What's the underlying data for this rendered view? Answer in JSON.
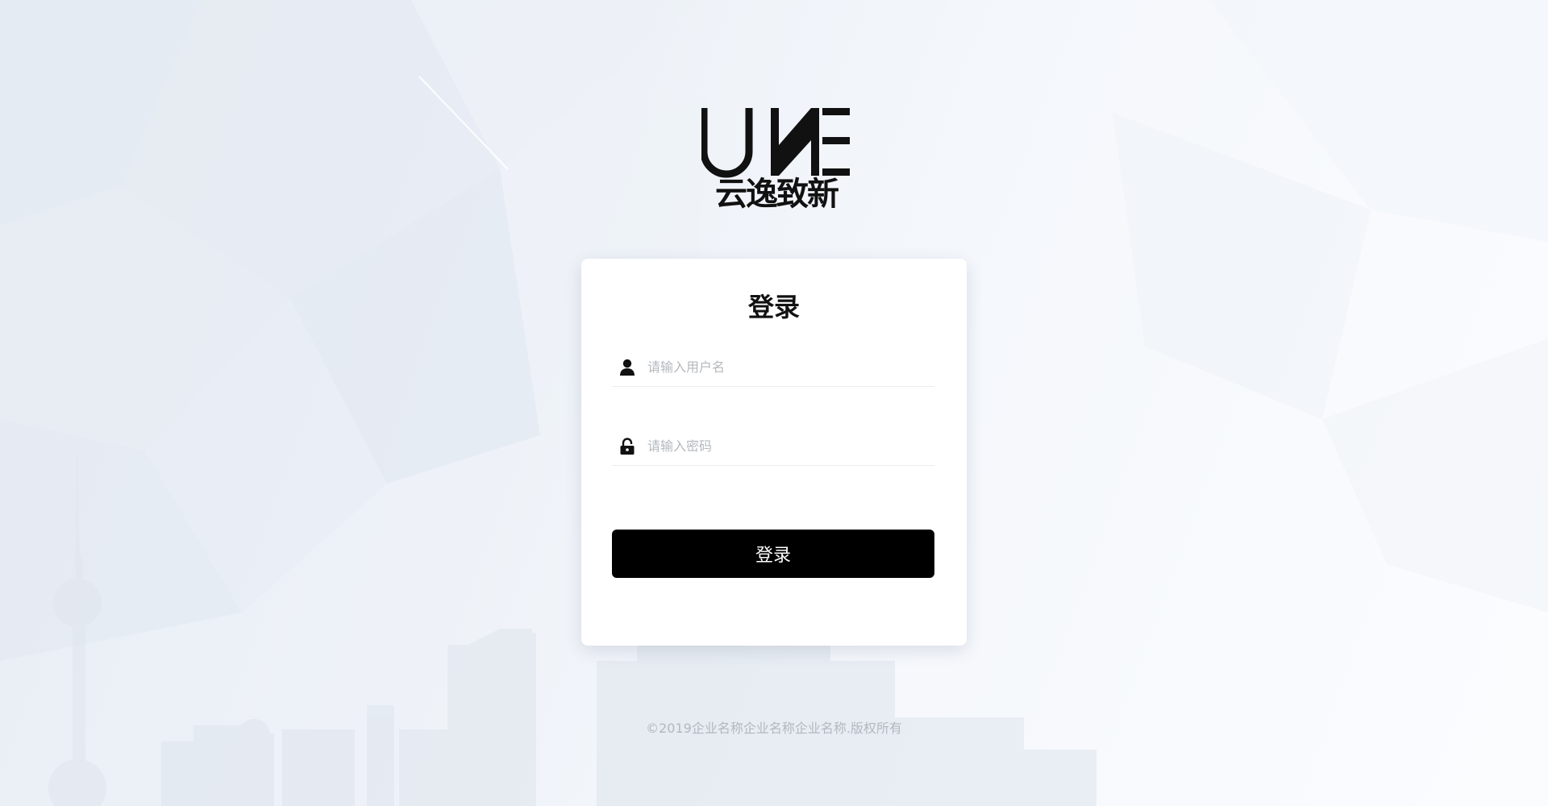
{
  "brand": {
    "logo_text": "UNE",
    "logo_cn": "云逸致新"
  },
  "login_card": {
    "title": "登录",
    "username": {
      "placeholder": "请输入用户名",
      "value": "",
      "icon": "user-icon"
    },
    "password": {
      "placeholder": "请输入密码",
      "value": "",
      "icon": "lock-icon"
    },
    "submit_label": "登录"
  },
  "footer": {
    "copyright": "©2019企业名称企业名称企业名称.版权所有"
  },
  "colors": {
    "primary_button": "#000000",
    "card_background": "#ffffff",
    "page_background": "#eef2f8",
    "placeholder_text": "#b4b8bd",
    "footer_text": "#b3b8bf"
  }
}
